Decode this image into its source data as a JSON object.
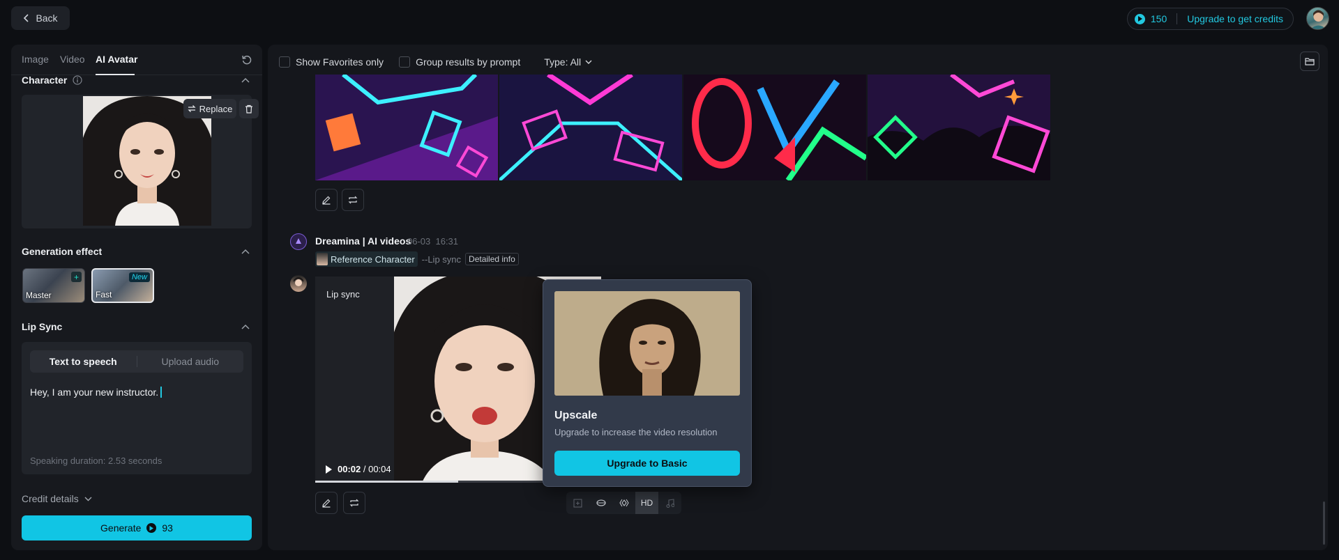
{
  "header": {
    "back_label": "Back",
    "credits_count": "150",
    "upgrade_label": "Upgrade to get credits"
  },
  "left_panel": {
    "tabs": [
      {
        "label": "Image"
      },
      {
        "label": "Video"
      },
      {
        "label": "AI Avatar"
      }
    ],
    "active_tab": "AI Avatar",
    "character": {
      "title": "Character",
      "replace_label": "Replace"
    },
    "generation_effect": {
      "title": "Generation effect",
      "options": [
        {
          "label": "Master",
          "badge": "+"
        },
        {
          "label": "Fast",
          "badge": "New"
        }
      ],
      "selected": "Fast"
    },
    "lip_sync": {
      "title": "Lip Sync",
      "modes": [
        "Text to speech",
        "Upload audio"
      ],
      "active_mode": "Text to speech",
      "text": "Hey, I am your new instructor.",
      "duration": "Speaking duration: 2.53 seconds"
    },
    "credit_details_label": "Credit details",
    "generate": {
      "label": "Generate",
      "cost": "93"
    }
  },
  "toolbar": {
    "show_favorites_label": "Show Favorites only",
    "group_results_label": "Group results by prompt",
    "type_label": "Type: All"
  },
  "generation": {
    "title": "Dreamina | AI videos",
    "date": "06-03",
    "time": "16:31",
    "reference_label": "Reference Character",
    "mode_label": "--Lip sync",
    "detail_label": "Detailed info"
  },
  "video": {
    "overlay_label": "Lip sync",
    "current_time": "00:02",
    "total_time": "/ 00:04",
    "progress": 0.5
  },
  "tools": {
    "hd_label": "HD"
  },
  "upscale_popover": {
    "title": "Upscale",
    "description": "Upgrade to increase the video resolution",
    "button_label": "Upgrade to Basic"
  },
  "colors": {
    "accent": "#11c5e4",
    "background": "#0d0f13",
    "panel": "#17191e",
    "popover": "#323a4a"
  }
}
